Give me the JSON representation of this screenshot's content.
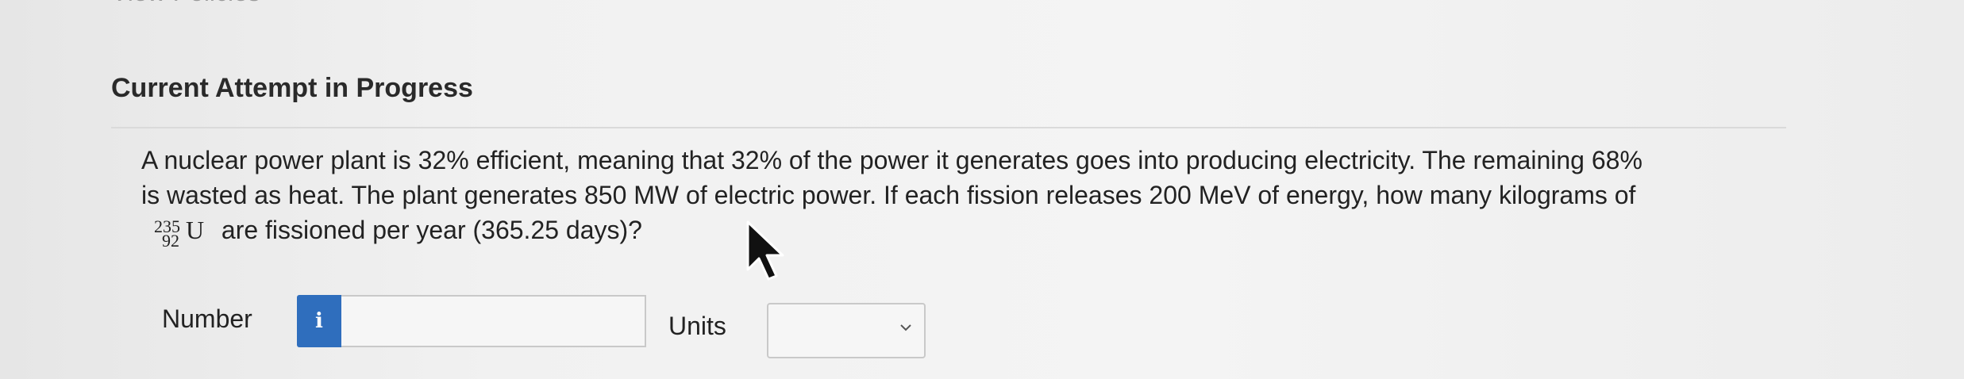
{
  "top_cut_text": "View Policies",
  "attempt": {
    "title": "Current Attempt in Progress"
  },
  "question": {
    "line1": "A nuclear power plant is 32% efficient, meaning that 32% of the power it generates goes into producing electricity. The remaining 68%",
    "line2": "is wasted as heat. The plant generates 850 MW of electric power. If each fission releases 200 MeV of energy, how many kilograms of",
    "nuclide_mass": "235",
    "nuclide_atomic": "92",
    "nuclide_symbol": "U",
    "line3_rest": "are fissioned per year (365.25 days)?"
  },
  "answer": {
    "number_label": "Number",
    "info_icon_glyph": "i",
    "number_value": "",
    "units_label": "Units",
    "units_selected": ""
  },
  "icons": {
    "info": "info-icon",
    "chevron": "chevron-down-icon",
    "cursor": "mouse-pointer-icon"
  },
  "colors": {
    "info_badge": "#2f6ebd",
    "background": "#ededed",
    "text": "#222222"
  }
}
